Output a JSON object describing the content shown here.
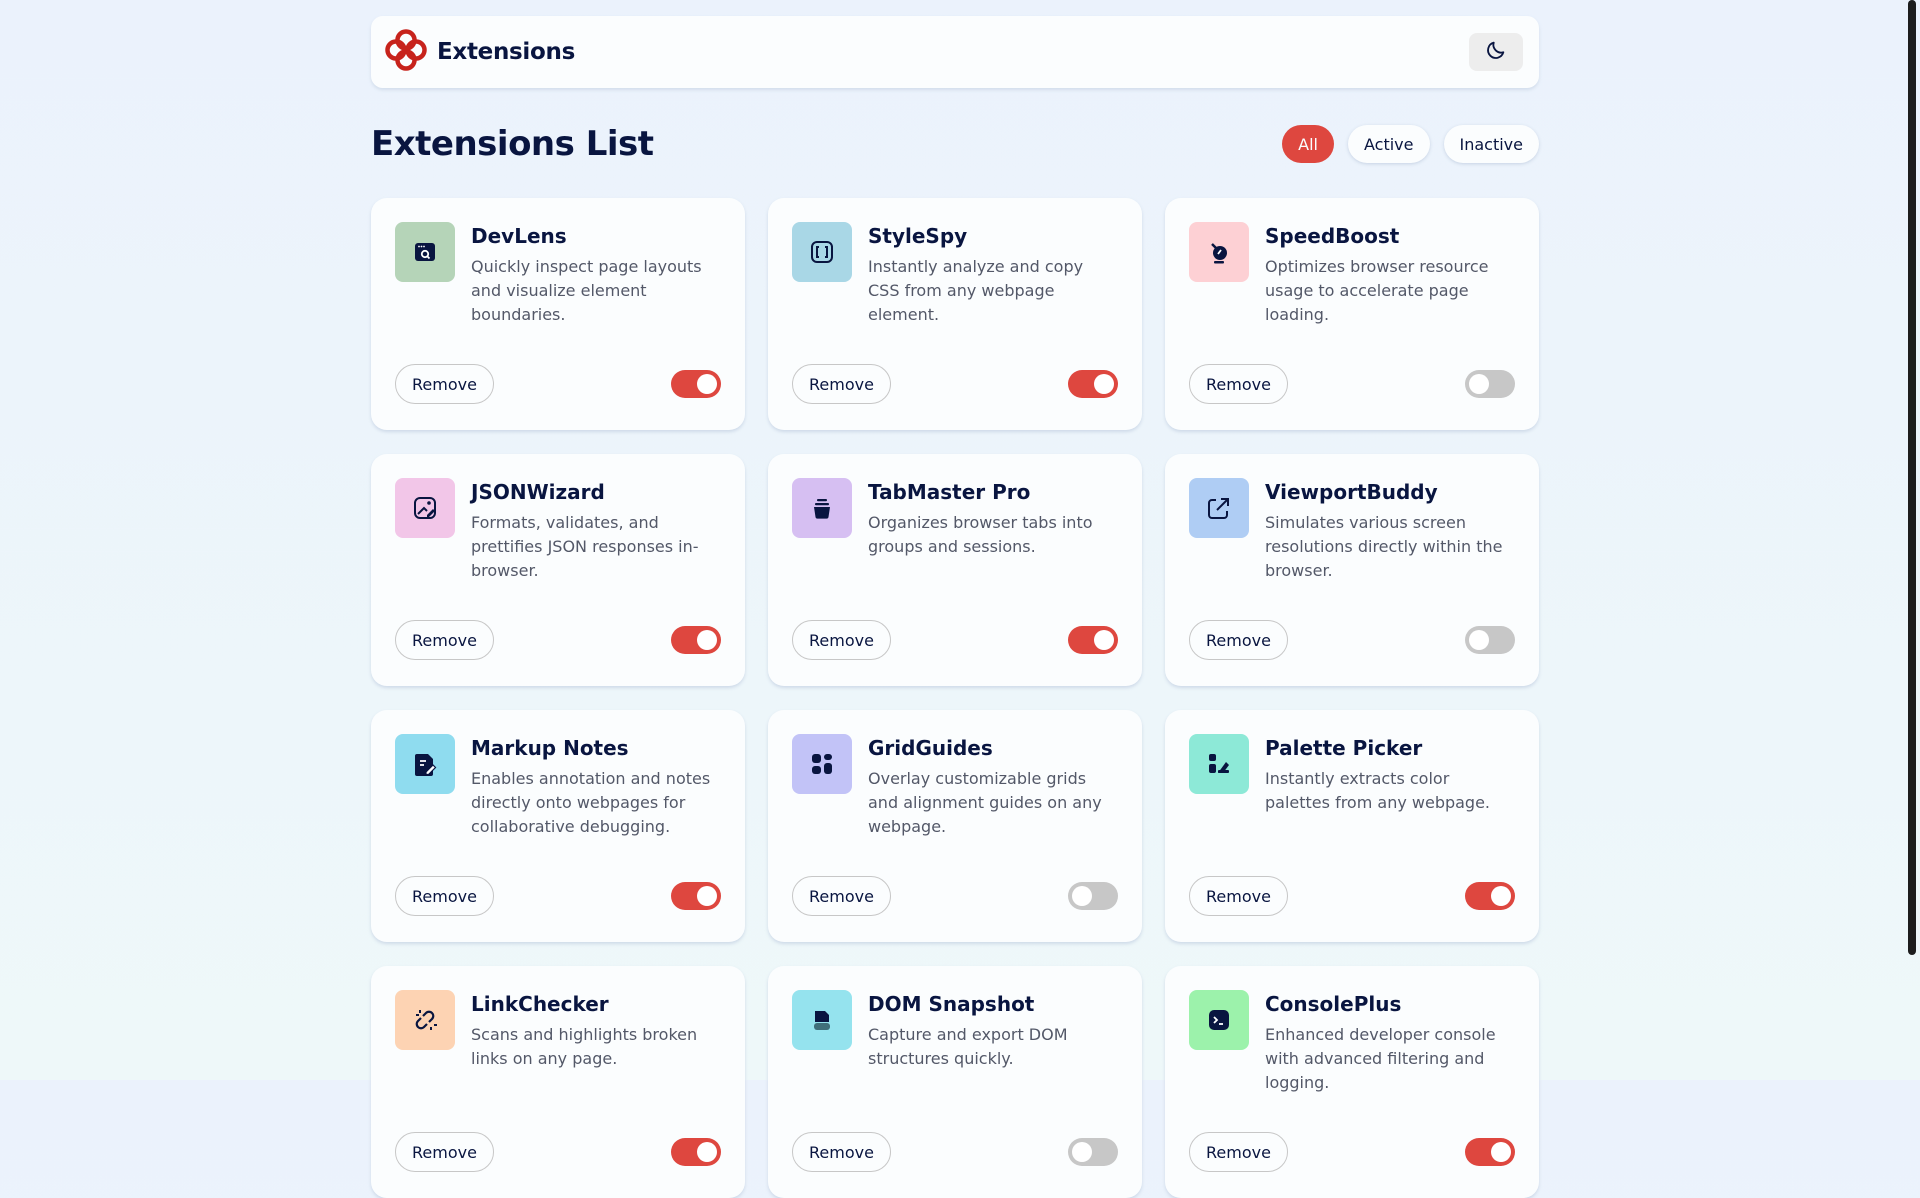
{
  "header": {
    "brand": "Extensions",
    "theme_icon": "moon-icon"
  },
  "list": {
    "title": "Extensions List",
    "filters": [
      {
        "label": "All",
        "active": true
      },
      {
        "label": "Active",
        "active": false
      },
      {
        "label": "Inactive",
        "active": false
      }
    ]
  },
  "remove_label": "Remove",
  "colors": {
    "accent": "#de473f",
    "toggle_off": "#c7c7c7"
  },
  "extensions": [
    {
      "name": "DevLens",
      "description": "Quickly inspect page layouts and visualize element boundaries.",
      "icon": "browser-search-icon",
      "icon_bg": "#b5d4b8",
      "enabled": true
    },
    {
      "name": "StyleSpy",
      "description": "Instantly analyze and copy CSS from any webpage element.",
      "icon": "code-brackets-icon",
      "icon_bg": "#a9d7e6",
      "enabled": true
    },
    {
      "name": "SpeedBoost",
      "description": "Optimizes browser resource usage to accelerate page loading.",
      "icon": "rocket-gauge-icon",
      "icon_bg": "#fdd0d4",
      "enabled": false
    },
    {
      "name": "JSONWizard",
      "description": "Formats, validates, and prettifies JSON responses in-browser.",
      "icon": "image-edit-icon",
      "icon_bg": "#f2c6e8",
      "enabled": true
    },
    {
      "name": "TabMaster Pro",
      "description": "Organizes browser tabs into groups and sessions.",
      "icon": "stack-jar-icon",
      "icon_bg": "#d6bff2",
      "enabled": true
    },
    {
      "name": "ViewportBuddy",
      "description": "Simulates various screen resolutions directly within the browser.",
      "icon": "external-link-icon",
      "icon_bg": "#afcdf4",
      "enabled": false
    },
    {
      "name": "Markup Notes",
      "description": "Enables annotation and notes directly onto webpages for collaborative debugging.",
      "icon": "note-pen-icon",
      "icon_bg": "#8fdcef",
      "enabled": true
    },
    {
      "name": "GridGuides",
      "description": "Overlay customizable grids and alignment guides on any webpage.",
      "icon": "grid-icon",
      "icon_bg": "#c2c3f7",
      "enabled": false
    },
    {
      "name": "Palette Picker",
      "description": "Instantly extracts color palettes from any webpage.",
      "icon": "palette-icon",
      "icon_bg": "#8de9d7",
      "enabled": true
    },
    {
      "name": "LinkChecker",
      "description": "Scans and highlights broken links on any page.",
      "icon": "broken-link-icon",
      "icon_bg": "#fdd3b3",
      "enabled": true
    },
    {
      "name": "DOM Snapshot",
      "description": "Capture and export DOM structures quickly.",
      "icon": "snapshot-icon",
      "icon_bg": "#95e3ee",
      "enabled": false
    },
    {
      "name": "ConsolePlus",
      "description": "Enhanced developer console with advanced filtering and logging.",
      "icon": "terminal-icon",
      "icon_bg": "#9cf2ab",
      "enabled": true
    }
  ]
}
